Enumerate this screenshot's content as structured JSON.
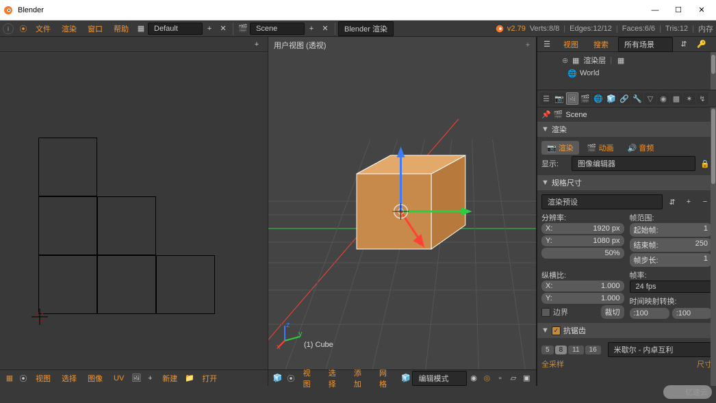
{
  "window": {
    "title": "Blender"
  },
  "topmenu": {
    "file": "文件",
    "render": "渲染",
    "window": "窗口",
    "help": "帮助",
    "layout": "Default",
    "scene": "Scene",
    "engine": "Blender 渲染",
    "version": "v2.79",
    "stats": {
      "verts": "Verts:8/8",
      "edges": "Edges:12/12",
      "faces": "Faces:6/6",
      "tris": "Tris:12",
      "mem": "内存"
    }
  },
  "outliner": {
    "view": "视图",
    "search": "搜索",
    "allscenes": "所有场景",
    "items": [
      {
        "name": "渲染层",
        "icon": "layers-icon",
        "indent": 1,
        "extra": true
      },
      {
        "name": "World",
        "icon": "world-icon",
        "indent": 2,
        "extra": false
      }
    ]
  },
  "props": {
    "crumb_scene": "Scene",
    "panels": {
      "render": {
        "title": "渲染",
        "btn_render": "渲染",
        "btn_anim": "动画",
        "btn_audio": "音频",
        "display_lbl": "显示:",
        "display_val": "图像编辑器"
      },
      "dims": {
        "title": "规格尺寸",
        "preset": "渲染预设",
        "res_lbl": "分辨率:",
        "x": "1920 px",
        "y": "1080 px",
        "pct": "50%",
        "range_lbl": "帧范围:",
        "start_lbl": "起始帧:",
        "start": "1",
        "end_lbl": "结束帧:",
        "end": "250",
        "step_lbl": "帧步长:",
        "step": "1",
        "aspect_lbl": "纵横比:",
        "ax": "1.000",
        "ay": "1.000",
        "rate_lbl": "帧率:",
        "rate": "24 fps",
        "remap_lbl": "时间映射转换:",
        "old": ":100",
        "new": ":100",
        "border_lbl": "边界",
        "crop_lbl": "裁切"
      },
      "aa": {
        "title": "抗锯齿",
        "levels": [
          "5",
          "8",
          "11",
          "16"
        ],
        "active": "8",
        "mitchell": "米歇尔 - 内卓互利",
        "fullsample": "全采样",
        "size_lbl": "尺寸"
      }
    }
  },
  "viewport3d": {
    "label": "用户视图 (透视)",
    "object": "(1) Cube",
    "axis": {
      "x": "x",
      "y": "y",
      "z": "z"
    }
  },
  "footer_uv": {
    "view": "视图",
    "select": "选择",
    "image": "图像",
    "uv": "UV",
    "new": "新建",
    "open": "打开"
  },
  "footer_3d": {
    "view": "视图",
    "select": "选择",
    "add": "添加",
    "mesh": "网格",
    "mode": "编辑模式"
  },
  "watermark": "亿速云"
}
